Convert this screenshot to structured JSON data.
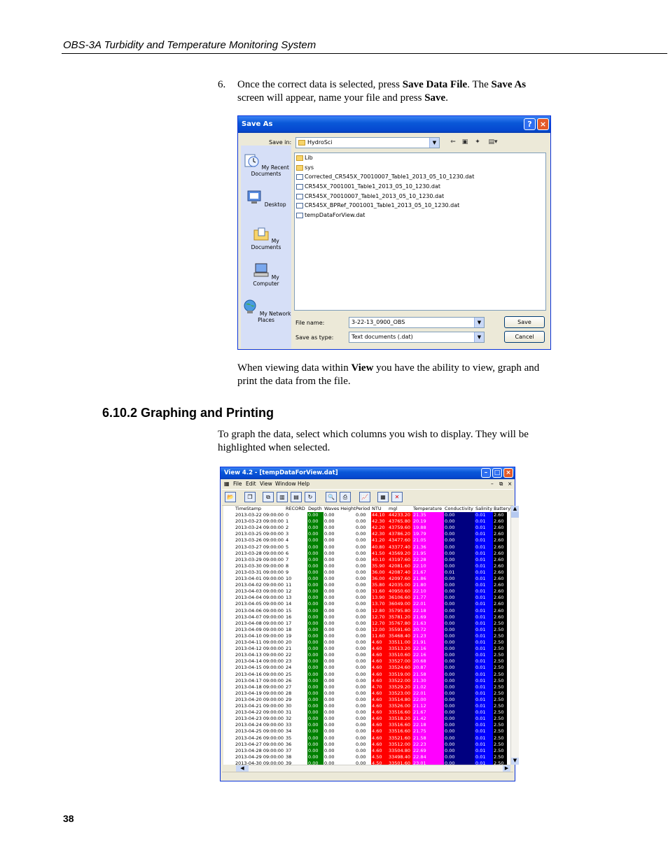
{
  "header": {
    "title": "OBS-3A Turbidity and Temperature Monitoring System"
  },
  "step6": {
    "number": "6.",
    "t1": "Once the correct data is selected, press ",
    "b1": "Save Data File",
    "t2": ".  The ",
    "b2": "Save As",
    "t3": " screen will appear, name your file and press ",
    "b3": "Save",
    "t4": "."
  },
  "save_dialog": {
    "title": "Save As",
    "help_btn": "?",
    "close_btn": "×",
    "save_in_label": "Save in:",
    "save_in_value": "HydroSci",
    "places": [
      "My Recent Documents",
      "Desktop",
      "My Documents",
      "My Computer",
      "My Network Places"
    ],
    "files": [
      {
        "name": "Lib",
        "kind": "folder"
      },
      {
        "name": "sys",
        "kind": "folder"
      },
      {
        "name": "Corrected_CR545X_70010007_Table1_2013_05_10_1230.dat",
        "kind": "file"
      },
      {
        "name": "CR545X_7001001_Table1_2013_05_10_1230.dat",
        "kind": "file"
      },
      {
        "name": "CR545X_70010007_Table1_2013_05_10_1230.dat",
        "kind": "file"
      },
      {
        "name": "CR545X_BPRef_7001001_Table1_2013_05_10_1230.dat",
        "kind": "file"
      },
      {
        "name": "tempDataForView.dat",
        "kind": "file"
      }
    ],
    "file_name_label": "File name:",
    "file_name_value": "3-22-13_0900_OBS",
    "save_type_label": "Save as type:",
    "save_type_value": "Text documents (.dat)",
    "save_button": "Save",
    "cancel_button": "Cancel"
  },
  "view_para": {
    "t1": "When viewing data within ",
    "b1": "View",
    "t2": " you have the ability to view, graph and print the data from the file."
  },
  "section": {
    "heading": "6.10.2  Graphing and Printing"
  },
  "graph_para": {
    "text": "To graph the data, select which columns you wish to display.  They will be highlighted when selected."
  },
  "view_window": {
    "title": "View 4.2 - [tempDataForView.dat]",
    "menu": [
      "File",
      "Edit",
      "View",
      "Window",
      "Help"
    ],
    "columns": [
      "TimeStamp",
      "RECORD",
      "Depth",
      "Waves Height",
      "Period",
      "NTU",
      "mgl",
      "Temperature",
      "Conductivity",
      "Salinity",
      "Battery"
    ],
    "column_colors": {
      "Depth": "#008000",
      "NTU": "#ff0000",
      "mgl": "#ff0000",
      "Temperature": "#ff00ff",
      "Conductivity": "#000080",
      "Salinity": "#0000ff",
      "Battery": "#000000"
    },
    "rows": [
      [
        "2013-03-22 09:00:00",
        "0",
        "0.00",
        "0.00",
        "0.00",
        "44.10",
        "44233.20",
        "21.35",
        "0.00",
        "0.01",
        "2.60"
      ],
      [
        "2013-03-23 09:00:00",
        "1",
        "0.00",
        "0.00",
        "0.00",
        "42.30",
        "43765.80",
        "20.19",
        "0.00",
        "0.01",
        "2.60"
      ],
      [
        "2013-03-24 09:00:00",
        "2",
        "0.00",
        "0.00",
        "0.00",
        "42.20",
        "43759.60",
        "19.88",
        "0.00",
        "0.01",
        "2.60"
      ],
      [
        "2013-03-25 09:00:00",
        "3",
        "0.00",
        "0.00",
        "0.00",
        "42.30",
        "43786.20",
        "19.79",
        "0.00",
        "0.01",
        "2.60"
      ],
      [
        "2013-03-26 09:00:00",
        "4",
        "0.00",
        "0.00",
        "0.00",
        "41.20",
        "43477.60",
        "21.05",
        "0.00",
        "0.01",
        "2.60"
      ],
      [
        "2013-03-27 09:00:00",
        "5",
        "0.00",
        "0.00",
        "0.00",
        "40.80",
        "43377.40",
        "21.36",
        "0.00",
        "0.01",
        "2.60"
      ],
      [
        "2013-03-28 09:00:00",
        "6",
        "0.00",
        "0.00",
        "0.00",
        "41.50",
        "43569.20",
        "21.95",
        "0.00",
        "0.01",
        "2.60"
      ],
      [
        "2013-03-29 09:00:00",
        "7",
        "0.00",
        "0.00",
        "0.00",
        "40.10",
        "43197.60",
        "22.28",
        "0.00",
        "0.01",
        "2.60"
      ],
      [
        "2013-03-30 09:00:00",
        "8",
        "0.00",
        "0.00",
        "0.00",
        "35.90",
        "42081.60",
        "22.10",
        "0.00",
        "0.01",
        "2.60"
      ],
      [
        "2013-03-31 09:00:00",
        "9",
        "0.00",
        "0.00",
        "0.00",
        "36.00",
        "42087.40",
        "21.67",
        "0.01",
        "0.01",
        "2.60"
      ],
      [
        "2013-04-01 09:00:00",
        "10",
        "0.00",
        "0.00",
        "0.00",
        "36.00",
        "42097.60",
        "21.86",
        "0.00",
        "0.01",
        "2.60"
      ],
      [
        "2013-04-02 09:00:00",
        "11",
        "0.00",
        "0.00",
        "0.00",
        "35.80",
        "42035.00",
        "21.80",
        "0.00",
        "0.01",
        "2.60"
      ],
      [
        "2013-04-03 09:00:00",
        "12",
        "0.00",
        "0.00",
        "0.00",
        "31.60",
        "40950.60",
        "22.10",
        "0.00",
        "0.01",
        "2.60"
      ],
      [
        "2013-04-04 09:00:00",
        "13",
        "0.00",
        "0.00",
        "0.00",
        "13.90",
        "36106.60",
        "21.77",
        "0.00",
        "0.01",
        "2.60"
      ],
      [
        "2013-04-05 09:00:00",
        "14",
        "0.00",
        "0.00",
        "0.00",
        "13.70",
        "36049.00",
        "22.01",
        "0.00",
        "0.01",
        "2.60"
      ],
      [
        "2013-04-06 09:00:00",
        "15",
        "0.00",
        "0.00",
        "0.00",
        "12.80",
        "35795.80",
        "22.18",
        "0.00",
        "0.01",
        "2.60"
      ],
      [
        "2013-04-07 09:00:00",
        "16",
        "0.00",
        "0.00",
        "0.00",
        "12.70",
        "35781.20",
        "21.69",
        "0.00",
        "0.01",
        "2.60"
      ],
      [
        "2013-04-08 09:00:00",
        "17",
        "0.00",
        "0.00",
        "0.00",
        "12.70",
        "35767.80",
        "21.63",
        "0.00",
        "0.01",
        "2.50"
      ],
      [
        "2013-04-09 09:00:00",
        "18",
        "0.00",
        "0.00",
        "0.00",
        "12.00",
        "35591.60",
        "20.72",
        "0.00",
        "0.01",
        "2.50"
      ],
      [
        "2013-04-10 09:00:00",
        "19",
        "0.00",
        "0.00",
        "0.00",
        "11.60",
        "35468.40",
        "21.23",
        "0.00",
        "0.01",
        "2.50"
      ],
      [
        "2013-04-11 09:00:00",
        "20",
        "0.00",
        "0.00",
        "0.00",
        "4.60",
        "33511.00",
        "21.91",
        "0.00",
        "0.01",
        "2.50"
      ],
      [
        "2013-04-12 09:00:00",
        "21",
        "0.00",
        "0.00",
        "0.00",
        "4.60",
        "33513.20",
        "22.16",
        "0.00",
        "0.01",
        "2.50"
      ],
      [
        "2013-04-13 09:00:00",
        "22",
        "0.00",
        "0.00",
        "0.00",
        "4.60",
        "33510.60",
        "22.16",
        "0.00",
        "0.01",
        "2.50"
      ],
      [
        "2013-04-14 09:00:00",
        "23",
        "0.00",
        "0.00",
        "0.00",
        "4.60",
        "33527.00",
        "20.68",
        "0.00",
        "0.01",
        "2.50"
      ],
      [
        "2013-04-15 09:00:00",
        "24",
        "0.00",
        "0.00",
        "0.00",
        "4.60",
        "33524.60",
        "20.87",
        "0.00",
        "0.01",
        "2.50"
      ],
      [
        "2013-04-16 09:00:00",
        "25",
        "0.00",
        "0.00",
        "0.00",
        "4.60",
        "33519.00",
        "21.58",
        "0.00",
        "0.01",
        "2.50"
      ],
      [
        "2013-04-17 09:00:00",
        "26",
        "0.00",
        "0.00",
        "0.00",
        "4.60",
        "33522.00",
        "21.30",
        "0.00",
        "0.01",
        "2.50"
      ],
      [
        "2013-04-18 09:00:00",
        "27",
        "0.00",
        "0.00",
        "0.00",
        "4.70",
        "33529.20",
        "21.02",
        "0.00",
        "0.01",
        "2.50"
      ],
      [
        "2013-04-19 09:00:00",
        "28",
        "0.00",
        "0.00",
        "0.00",
        "4.60",
        "33523.00",
        "22.01",
        "0.00",
        "0.01",
        "2.50"
      ],
      [
        "2013-04-20 09:00:00",
        "29",
        "0.00",
        "0.00",
        "0.00",
        "4.60",
        "33514.80",
        "22.00",
        "0.00",
        "0.01",
        "2.50"
      ],
      [
        "2013-04-21 09:00:00",
        "30",
        "0.00",
        "0.00",
        "0.00",
        "4.60",
        "33526.00",
        "21.12",
        "0.00",
        "0.01",
        "2.50"
      ],
      [
        "2013-04-22 09:00:00",
        "31",
        "0.00",
        "0.00",
        "0.00",
        "4.60",
        "33516.60",
        "21.67",
        "0.00",
        "0.01",
        "2.50"
      ],
      [
        "2013-04-23 09:00:00",
        "32",
        "0.00",
        "0.00",
        "0.00",
        "4.60",
        "33518.20",
        "21.42",
        "0.00",
        "0.01",
        "2.50"
      ],
      [
        "2013-04-24 09:00:00",
        "33",
        "0.00",
        "0.00",
        "0.00",
        "4.60",
        "33516.60",
        "22.18",
        "0.00",
        "0.01",
        "2.50"
      ],
      [
        "2013-04-25 09:00:00",
        "34",
        "0.00",
        "0.00",
        "0.00",
        "4.60",
        "33516.60",
        "21.75",
        "0.00",
        "0.01",
        "2.50"
      ],
      [
        "2013-04-26 09:00:00",
        "35",
        "0.00",
        "0.00",
        "0.00",
        "4.60",
        "33521.60",
        "21.58",
        "0.00",
        "0.01",
        "2.50"
      ],
      [
        "2013-04-27 09:00:00",
        "36",
        "0.00",
        "0.00",
        "0.00",
        "4.60",
        "33512.00",
        "22.23",
        "0.00",
        "0.01",
        "2.50"
      ],
      [
        "2013-04-28 09:00:00",
        "37",
        "0.00",
        "0.00",
        "0.00",
        "4.60",
        "33504.80",
        "22.69",
        "0.00",
        "0.01",
        "2.50"
      ],
      [
        "2013-04-29 09:00:00",
        "38",
        "0.00",
        "0.00",
        "0.00",
        "4.50",
        "33498.40",
        "22.84",
        "0.00",
        "0.01",
        "2.50"
      ],
      [
        "2013-04-30 09:00:00",
        "39",
        "0.00",
        "0.00",
        "0.00",
        "4.50",
        "33501.60",
        "23.01",
        "0.00",
        "0.01",
        "2.50"
      ]
    ]
  },
  "footer": {
    "page_number": "38"
  }
}
